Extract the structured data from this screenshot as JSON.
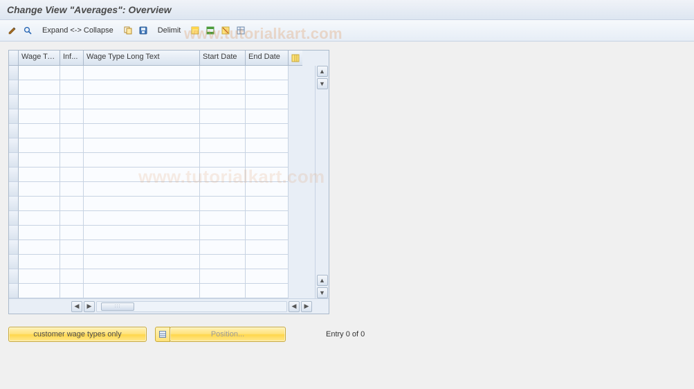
{
  "title": "Change View \"Averages\": Overview",
  "toolbar": {
    "expand_collapse_label": "Expand <-> Collapse",
    "delimit_label": "Delimit"
  },
  "grid": {
    "columns": [
      "Wage Ty...",
      "Inf...",
      "Wage Type Long Text",
      "Start Date",
      "End Date"
    ],
    "row_count": 16
  },
  "footer": {
    "customer_button": "customer wage types only",
    "position_button": "Position...",
    "entry_text": "Entry 0 of 0"
  },
  "watermark": "www.tutorialkart.com"
}
